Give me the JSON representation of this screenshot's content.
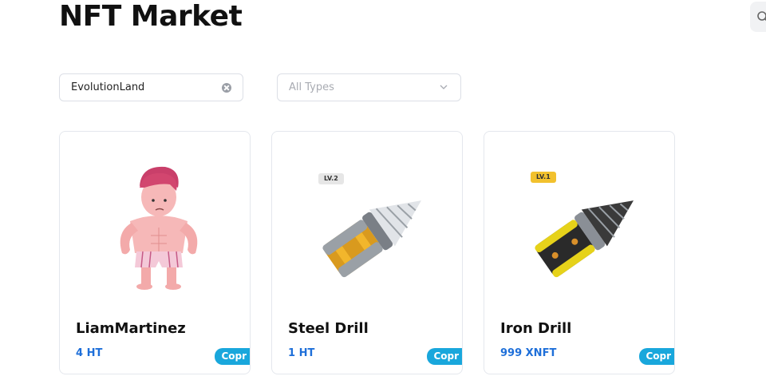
{
  "page": {
    "title": "NFT Market"
  },
  "filters": {
    "search_value": "EvolutionLand",
    "type_placeholder": "All Types"
  },
  "cards": [
    {
      "name": "LiamMartinez",
      "price": "4 HT",
      "badge": "Copr",
      "level": "",
      "image": "muscle-man-character"
    },
    {
      "name": "Steel Drill",
      "price": "1 HT",
      "badge": "Copr",
      "level": "LV.2",
      "image": "steel-drill"
    },
    {
      "name": "Iron Drill",
      "price": "999 XNFT",
      "badge": "Copr",
      "level": "LV.1",
      "image": "iron-drill"
    }
  ],
  "colors": {
    "price": "#1e6fd9",
    "badge": "#19a7dc",
    "lv1": "#f2c12e",
    "lv2": "#e6e6e6"
  },
  "icons": {
    "top_search": "search-icon",
    "clear": "clear-icon",
    "select": "chevron-down-icon"
  }
}
